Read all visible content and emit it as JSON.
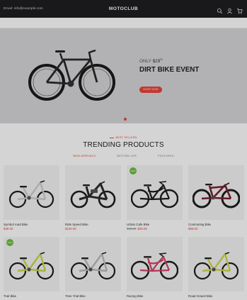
{
  "header": {
    "email": "Email: info@example.com",
    "logo": "MOTOCLUB",
    "icons": [
      "search-icon",
      "user-icon",
      "cart-icon"
    ]
  },
  "hero": {
    "only_prefix": "ONLY",
    "price": "$29",
    "price_cents": "99",
    "title": "DIRT BIKE EVENT",
    "button": "SHOP NOW"
  },
  "trending": {
    "eyebrow": "BEST SELLERS",
    "title": "TRENDING PRODUCTS",
    "tabs": [
      {
        "label": "NEW ARRIVALS",
        "active": true
      },
      {
        "label": "BESTSELLER",
        "active": false
      },
      {
        "label": "FEATURED",
        "active": false
      }
    ],
    "products": [
      {
        "name": "Symbol road Bike",
        "price": "$48.00",
        "old_price": "",
        "badge": "",
        "frame": "#cfcfcf",
        "style": "folding"
      },
      {
        "name": "Ride Speed Bike",
        "price": "$100.00",
        "old_price": "",
        "badge": "",
        "frame": "#2b2b2b",
        "style": "ebike"
      },
      {
        "name": "Urban Cafe Bike",
        "price": "$35.00",
        "old_price": "$38.00",
        "badge": "NEW",
        "frame": "#1c1c1c",
        "style": "cruiser"
      },
      {
        "name": "Commuting Bike",
        "price": "$88.00",
        "old_price": "",
        "badge": "",
        "frame": "#7a2030",
        "style": "mtb"
      },
      {
        "name": "Trail Bike",
        "price": "",
        "old_price": "",
        "badge": "NEW",
        "frame": "#c9d64a",
        "style": "folding"
      },
      {
        "name": "Time Trial Bike",
        "price": "",
        "old_price": "",
        "badge": "",
        "frame": "#bcbcbc",
        "style": "folding"
      },
      {
        "name": "Racing Bike",
        "price": "",
        "old_price": "",
        "badge": "",
        "frame": "#d8436a",
        "style": "cruiser"
      },
      {
        "name": "Road Gravel Bike",
        "price": "",
        "old_price": "",
        "badge": "",
        "frame": "#d3d64a",
        "style": "folding"
      }
    ]
  },
  "colors": {
    "accent": "#e8453c",
    "badge": "#6bbf3f",
    "header": "#1f1f21"
  }
}
